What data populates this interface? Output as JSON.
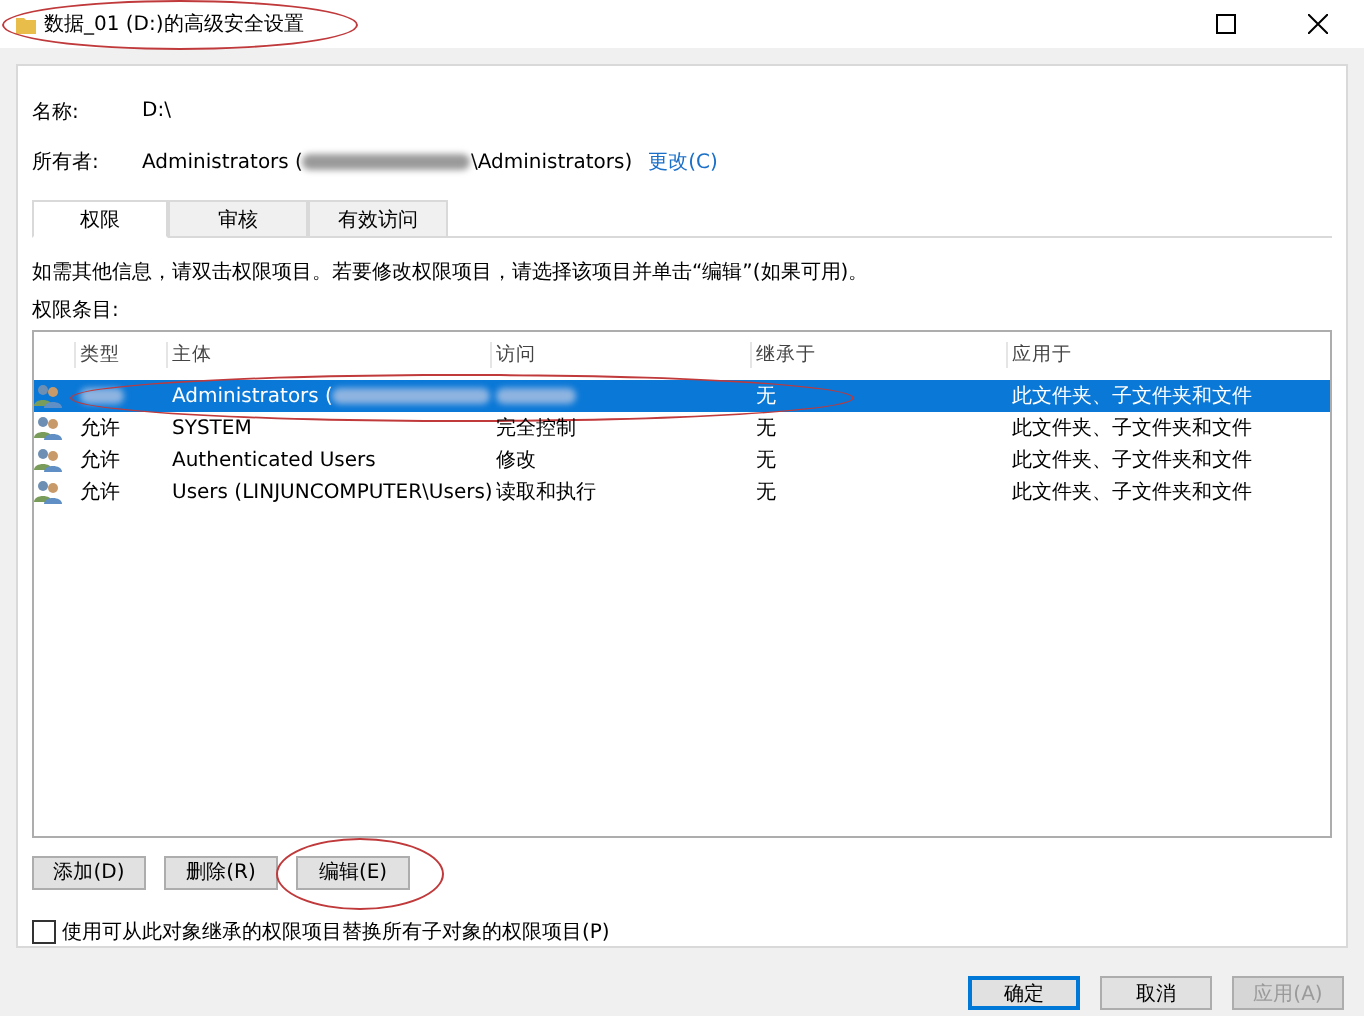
{
  "window": {
    "title": "数据_01 (D:)的高级安全设置",
    "title_circled": true
  },
  "name": {
    "label": "名称:",
    "value": "D:\\"
  },
  "owner": {
    "label": "所有者:",
    "value_start": "Administrators (",
    "value_redacted": true,
    "value_end": "\\Administrators)",
    "link": "更改(C)"
  },
  "tabs": [
    {
      "label": "权限",
      "selected": true
    },
    {
      "label": "审核",
      "selected": false
    },
    {
      "label": "有效访问",
      "selected": false
    }
  ],
  "description": "如需其他信息，请双击权限项目。若要修改权限项目，请选择该项目并单击“编辑”(如果可用)。",
  "list_label": "权限条目:",
  "table": {
    "columns": [
      "类型",
      "主体",
      "访问",
      "继承于",
      "应用于"
    ],
    "rows": [
      {
        "selected": true,
        "circled": true,
        "type_redacted": true,
        "principal": "Administrators (",
        "principal_redacted": true,
        "access_redacted": true,
        "inherited": "无",
        "applies": "此文件夹、子文件夹和文件"
      },
      {
        "selected": false,
        "circled": false,
        "type": "允许",
        "type_redacted": false,
        "principal": "SYSTEM",
        "principal_redacted": false,
        "access": "完全控制",
        "access_redacted": false,
        "inherited": "无",
        "applies": "此文件夹、子文件夹和文件"
      },
      {
        "selected": false,
        "circled": false,
        "type": "允许",
        "type_redacted": false,
        "principal": "Authenticated Users",
        "principal_redacted": false,
        "access": "修改",
        "access_redacted": false,
        "inherited": "无",
        "applies": "此文件夹、子文件夹和文件"
      },
      {
        "selected": false,
        "circled": false,
        "type": "允许",
        "type_redacted": false,
        "principal": "Users (LINJUNCOMPUTER\\Users)",
        "principal_redacted": false,
        "access": "读取和执行",
        "access_redacted": false,
        "inherited": "无",
        "applies": "此文件夹、子文件夹和文件"
      }
    ]
  },
  "entry_buttons": [
    {
      "label": "添加(D)",
      "circled": false
    },
    {
      "label": "删除(R)",
      "circled": false
    },
    {
      "label": "编辑(E)",
      "circled": true
    }
  ],
  "replace_checkbox": {
    "label": "使用可从此对象继承的权限项目替换所有子对象的权限项目(P)",
    "checked": false
  },
  "dialog_buttons": [
    {
      "label": "确定",
      "default": true,
      "disabled": false
    },
    {
      "label": "取消",
      "default": false,
      "disabled": false
    },
    {
      "label": "应用(A)",
      "default": false,
      "disabled": true
    }
  ]
}
